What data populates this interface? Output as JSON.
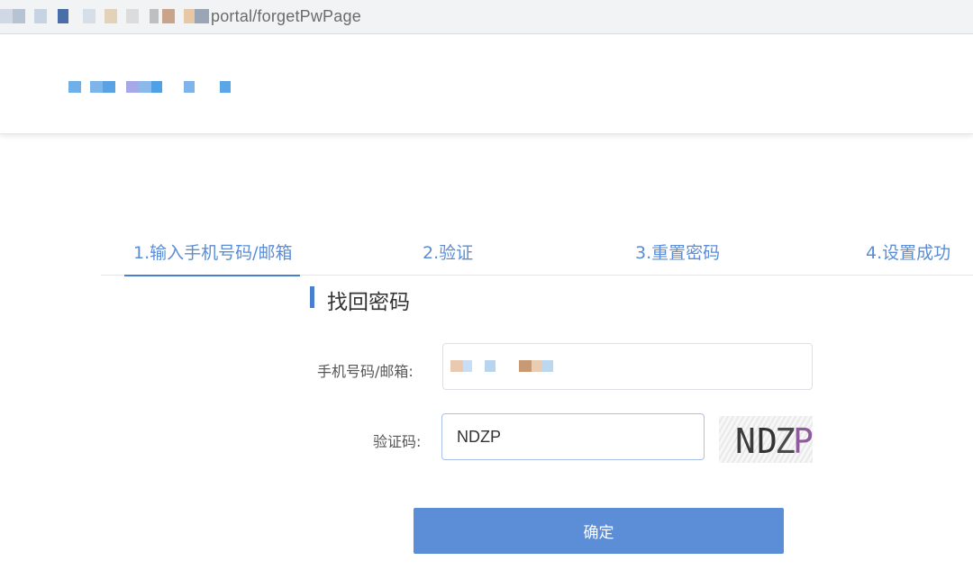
{
  "browser": {
    "url_visible": "portal/forgetPwPage"
  },
  "steps": [
    {
      "label": "1.输入手机号码/邮箱",
      "active": true
    },
    {
      "label": "2.验证",
      "active": false
    },
    {
      "label": "3.重置密码",
      "active": false
    },
    {
      "label": "4.设置成功",
      "active": false
    }
  ],
  "form": {
    "title": "找回密码",
    "account_label": "手机号码/邮箱:",
    "account_value": "",
    "captcha_label": "验证码:",
    "captcha_value": "NDZP",
    "captcha_image_text": "NDZP",
    "submit_label": "确定"
  },
  "colors": {
    "accent": "#4a7fcf",
    "step_text": "#5b8dd6",
    "button": "#5b8ed6"
  }
}
